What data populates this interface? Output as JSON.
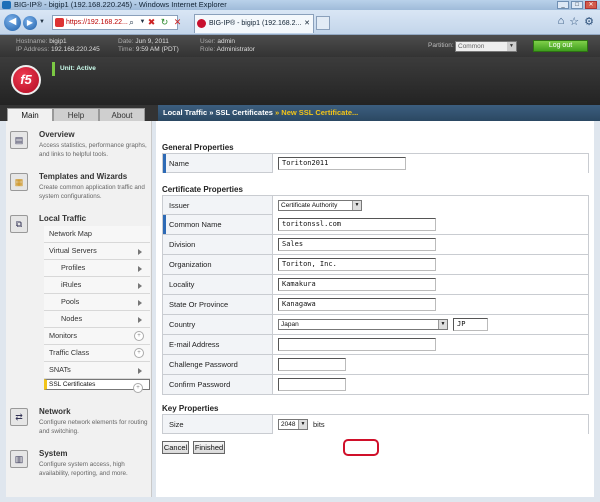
{
  "window": {
    "title": "BIG-IP® - bigip1 (192.168.220.245) - Windows Internet Explorer"
  },
  "browser": {
    "address": "https://192.168.22...",
    "tab_title": "BIG-IP® - bigip1 (192.168.2..."
  },
  "header": {
    "hostname_label": "Hostname:",
    "hostname": "bigip1",
    "ip_label": "IP Address:",
    "ip": "192.168.220.245",
    "date_label": "Date:",
    "date": "Jun 9, 2011",
    "time_label": "Time:",
    "time": "9:59 AM (PDT)",
    "user_label": "User:",
    "user": "admin",
    "role_label": "Role:",
    "role": "Administrator",
    "partition_label": "Partition:",
    "partition": "Common",
    "logout": "Log out",
    "unit_status": "Unit: Active"
  },
  "tabs": [
    {
      "label": "Main"
    },
    {
      "label": "Help"
    },
    {
      "label": "About"
    }
  ],
  "breadcrumb": {
    "part1": "Local Traffic",
    "sep": "»",
    "part2": "SSL Certificates",
    "sep2": "»",
    "current": "New SSL Certificate..."
  },
  "nav": {
    "overview": {
      "title": "Overview",
      "desc": "Access statistics, performance graphs, and links to helpful tools."
    },
    "templates": {
      "title": "Templates and Wizards",
      "desc": "Create common application traffic and system configurations."
    },
    "local_traffic": {
      "title": "Local Traffic",
      "items": [
        {
          "label": "Network Map"
        },
        {
          "label": "Virtual Servers"
        },
        {
          "label": "Profiles"
        },
        {
          "label": "iRules"
        },
        {
          "label": "Pools"
        },
        {
          "label": "Nodes"
        },
        {
          "label": "Monitors"
        },
        {
          "label": "Traffic Class"
        },
        {
          "label": "SNATs"
        },
        {
          "label": "SSL Certificates"
        }
      ]
    },
    "network": {
      "title": "Network",
      "desc": "Configure network elements for routing and switching."
    },
    "system": {
      "title": "System",
      "desc": "Configure system access, high availability, reporting, and more."
    }
  },
  "form": {
    "general_title": "General Properties",
    "name_label": "Name",
    "name_value": "Toriton2011",
    "cert_title": "Certificate Properties",
    "issuer_label": "Issuer",
    "issuer_value": "Certificate Authority",
    "common_name_label": "Common Name",
    "common_name_value": "toritonssl.com",
    "division_label": "Division",
    "division_value": "Sales",
    "organization_label": "Organization",
    "organization_value": "Toriton, Inc.",
    "locality_label": "Locality",
    "locality_value": "Kamakura",
    "state_label": "State Or Province",
    "state_value": "Kanagawa",
    "country_label": "Country",
    "country_value": "Japan",
    "country_code": "JP",
    "email_label": "E-mail Address",
    "email_value": "",
    "challenge_label": "Challenge Password",
    "challenge_value": "",
    "confirm_label": "Confirm Password",
    "confirm_value": "",
    "key_title": "Key Properties",
    "size_label": "Size",
    "size_value": "2048",
    "size_unit": "bits",
    "cancel": "Cancel",
    "finished": "Finished"
  }
}
